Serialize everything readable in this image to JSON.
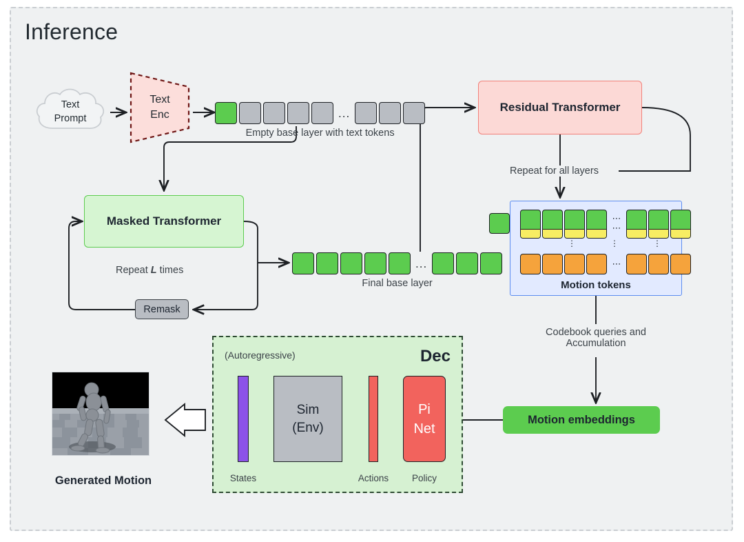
{
  "panel": {
    "title": "Inference"
  },
  "text_prompt": {
    "icon": "cloud-icon",
    "line1": "Text",
    "line2": "Prompt"
  },
  "text_encoder": {
    "line1": "Text",
    "line2": "Enc"
  },
  "empty_base_layer": {
    "caption": "Empty base layer with text tokens",
    "ellipsis": "...",
    "left_tokens": [
      "green",
      "gray",
      "gray",
      "gray",
      "gray"
    ],
    "right_tokens": [
      "gray",
      "gray",
      "gray"
    ]
  },
  "masked_transformer": {
    "label": "Masked Transformer"
  },
  "repeat_note": {
    "prefix": "Repeat ",
    "emphasis": "L",
    "suffix": " times"
  },
  "remask": {
    "label": "Remask"
  },
  "final_base_layer": {
    "caption": "Final base layer",
    "ellipsis": "...",
    "left_tokens": [
      "green",
      "green",
      "green",
      "green",
      "green"
    ],
    "right_tokens": [
      "green",
      "green",
      "green"
    ]
  },
  "residual_transformer": {
    "label": "Residual Transformer"
  },
  "repeat_layers_note": {
    "label": "Repeat for all layers"
  },
  "motion_tokens": {
    "label": "Motion tokens",
    "base_token": "green",
    "h_ellipsis": "⋯",
    "v_ellipsis": "⋮",
    "top_row_left": [
      "green-yellow",
      "green-yellow",
      "green-yellow",
      "green-yellow"
    ],
    "top_row_right": [
      "green-yellow",
      "green-yellow",
      "green-yellow"
    ],
    "bottom_row_left": [
      "orange",
      "orange",
      "orange",
      "orange"
    ],
    "bottom_row_right": [
      "orange",
      "orange",
      "orange"
    ]
  },
  "codebook_note": {
    "line1": "Codebook queries and",
    "line2": "Accumulation"
  },
  "motion_embeddings": {
    "label": "Motion embeddings"
  },
  "decoder": {
    "title": "Dec",
    "autoregressive": "(Autoregressive)",
    "states_label": "States",
    "sim_line1": "Sim",
    "sim_line2": "(Env)",
    "actions_label": "Actions",
    "policy_line1": "Pi",
    "policy_line2": "Net",
    "policy_label": "Policy"
  },
  "generated_motion": {
    "caption": "Generated Motion",
    "icon": "humanoid-render"
  },
  "colors": {
    "panel_bg": "#eff1f2",
    "green_token": "#5ccc4f",
    "gray_token": "#b9bdc3",
    "yellow_strip": "#f7ed63",
    "orange_token": "#f5a33c",
    "red_block": "#f2635d",
    "purple_block": "#8c52e8",
    "blue_panel": "#e2eaff",
    "pink_box": "#fcd9d6",
    "green_box": "#d6f5d2"
  }
}
